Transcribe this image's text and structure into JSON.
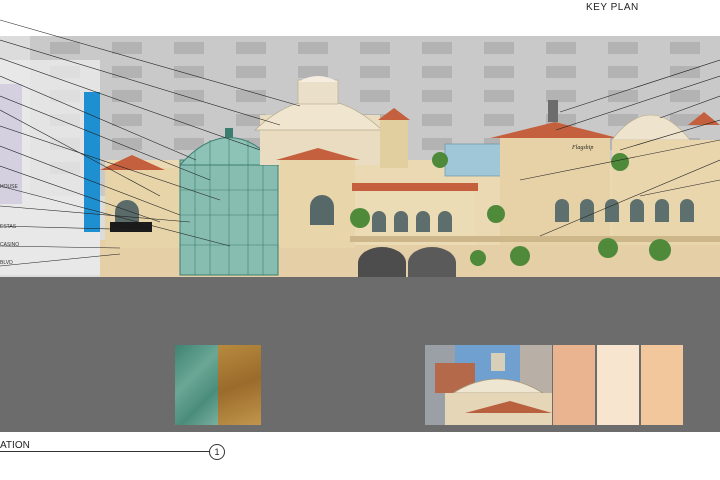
{
  "sheet": {
    "key_plan_label": "KEY PLAN",
    "elevation_label": "ATION",
    "elevation_number": "1"
  },
  "callouts": [
    "HOUSE",
    "ESTAS",
    "CASINO",
    "BLVD",
    "Flagship"
  ],
  "colors": {
    "sky": "#d9d9d9",
    "tower": "#c8c8c8",
    "ground_strip": "#6c6c6c",
    "glass_dome": "#7fb8a8",
    "stucco": "#e8d6b0",
    "roof_tile": "#c4603e",
    "accent_blue": "#1e8fd0",
    "accent_purple": "#7c6fb0"
  },
  "swatches": [
    {
      "name": "patina-copper",
      "color": "#4e8f7e"
    },
    {
      "name": "aged-bronze",
      "color": "#a97a3a"
    },
    {
      "name": "peach-stucco",
      "color": "#e9b48f"
    },
    {
      "name": "cream-stucco",
      "color": "#f8e5cf"
    },
    {
      "name": "sand-stucco",
      "color": "#f2c79b"
    }
  ]
}
